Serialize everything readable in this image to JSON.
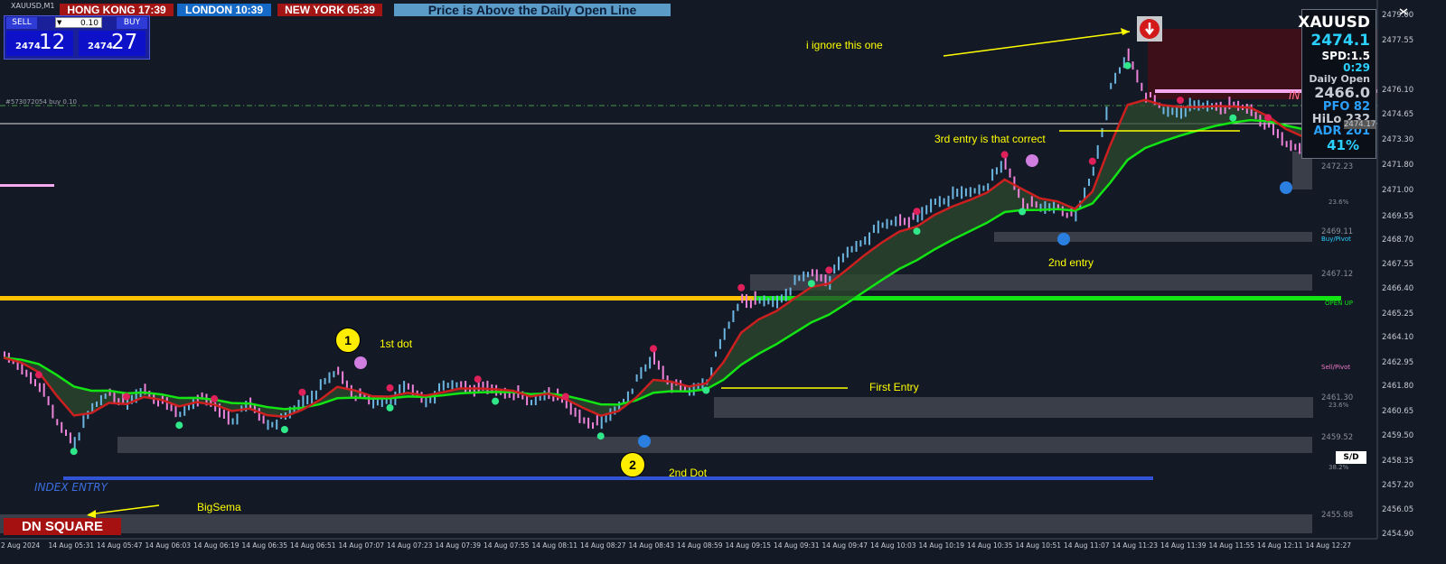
{
  "symbol_title": "XAUUSD,M1",
  "sessions": [
    {
      "label": "HONG KONG 17:39",
      "bg": "#a31515"
    },
    {
      "label": "LONDON  10:39",
      "bg": "#1569c7"
    },
    {
      "label": "NEW YORK  05:39",
      "bg": "#a31515"
    }
  ],
  "banner": "Price is Above the Daily Open Line",
  "trade_panel": {
    "sell_label": "SELL",
    "buy_label": "BUY",
    "lot": "0.10",
    "sell_prefix": "2474",
    "sell_big": "12",
    "buy_prefix": "2474",
    "buy_big": "27"
  },
  "order_line_label": "#573072054 buy 0.10",
  "info": {
    "symbol": "XAUUSD",
    "price": "2474.1",
    "spread": "SPD:1.5",
    "timer": "0:29",
    "daily_open_label": "Daily Open",
    "daily_open": "2466.0",
    "pfo": "PFO 82",
    "hilo": "HiLo 232",
    "adr": "ADR 201",
    "pct": "41%"
  },
  "annotations": {
    "ignore": "i ignore this one",
    "third": "3rd entry is that correct",
    "second_entry": "2nd entry",
    "first_dot": "1st dot",
    "first_entry": "First Entry",
    "second_dot": "2nd Dot",
    "bigsema": "BigSema",
    "dot1": "1",
    "dot2": "2"
  },
  "dn_square": "DN SQUARE",
  "index_entry": "INDEX ENTRY",
  "zone_labels": {
    "buy_pivot": "Buy/Pivot",
    "open_up": "OPEN UP",
    "sell_pivot": "Sell/Pivot",
    "sd": "S/D",
    "fib236": "23.6%",
    "fib382": "38.2%",
    "fib236b": "23.6%",
    "ind": "IN"
  },
  "zone_prices": {
    "z1": "2472.23",
    "z2": "2469.11",
    "z3": "2467.12",
    "z4": "2461.30",
    "z5": "2459.52",
    "z6": "2455.88",
    "z7": "2474.17"
  },
  "y_axis": [
    "2479.00",
    "2477.55",
    "2476.10",
    "2474.65",
    "2473.30",
    "2471.80",
    "2471.00",
    "2469.55",
    "2468.70",
    "2467.55",
    "2466.40",
    "2465.25",
    "2464.10",
    "2462.95",
    "2461.80",
    "2460.65",
    "2459.50",
    "2458.35",
    "2457.20",
    "2456.05",
    "2454.90"
  ],
  "x_axis": [
    "2 Aug 2024",
    "14 Aug 05:31",
    "14 Aug 05:47",
    "14 Aug 06:03",
    "14 Aug 06:19",
    "14 Aug 06:35",
    "14 Aug 06:51",
    "14 Aug 07:07",
    "14 Aug 07:23",
    "14 Aug 07:39",
    "14 Aug 07:55",
    "14 Aug 08:11",
    "14 Aug 08:27",
    "14 Aug 08:43",
    "14 Aug 08:59",
    "14 Aug 09:15",
    "14 Aug 09:31",
    "14 Aug 09:47",
    "14 Aug 10:03",
    "14 Aug 10:19",
    "14 Aug 10:35",
    "14 Aug 10:51",
    "14 Aug 11:07",
    "14 Aug 11:23",
    "14 Aug 11:39",
    "14 Aug 11:55",
    "14 Aug 12:11",
    "14 Aug 12:27"
  ],
  "chart_data": {
    "type": "candlestick",
    "close_series": [
      2463.0,
      2462.5,
      2461.8,
      2460.0,
      2459.2,
      2460.6,
      2461.5,
      2460.8,
      2461.6,
      2460.9,
      2460.4,
      2461.2,
      2460.7,
      2460.2,
      2460.8,
      2460.0,
      2460.2,
      2461.0,
      2461.6,
      2462.4,
      2461.3,
      2460.9,
      2461.2,
      2461.6,
      2461.1,
      2461.6,
      2461.8,
      2461.6,
      2461.5,
      2461.4,
      2460.9,
      2461.5,
      2460.8,
      2460.2,
      2459.9,
      2460.8,
      2461.9,
      2463.0,
      2461.8,
      2461.4,
      2462.0,
      2464.0,
      2465.8,
      2465.5,
      2465.6,
      2466.4,
      2466.9,
      2466.6,
      2467.8,
      2468.5,
      2469.0,
      2469.4,
      2469.3,
      2470.2,
      2470.4,
      2470.6,
      2471.0,
      2471.9,
      2470.2,
      2469.8,
      2470.0,
      2469.4,
      2471.6,
      2475.3,
      2476.9,
      2475.1,
      2474.3,
      2474.4,
      2474.5,
      2474.6,
      2474.5,
      2474.4,
      2473.6,
      2472.8,
      2472.7
    ],
    "daily_open": 2466.0,
    "current_price": 2474.1
  }
}
